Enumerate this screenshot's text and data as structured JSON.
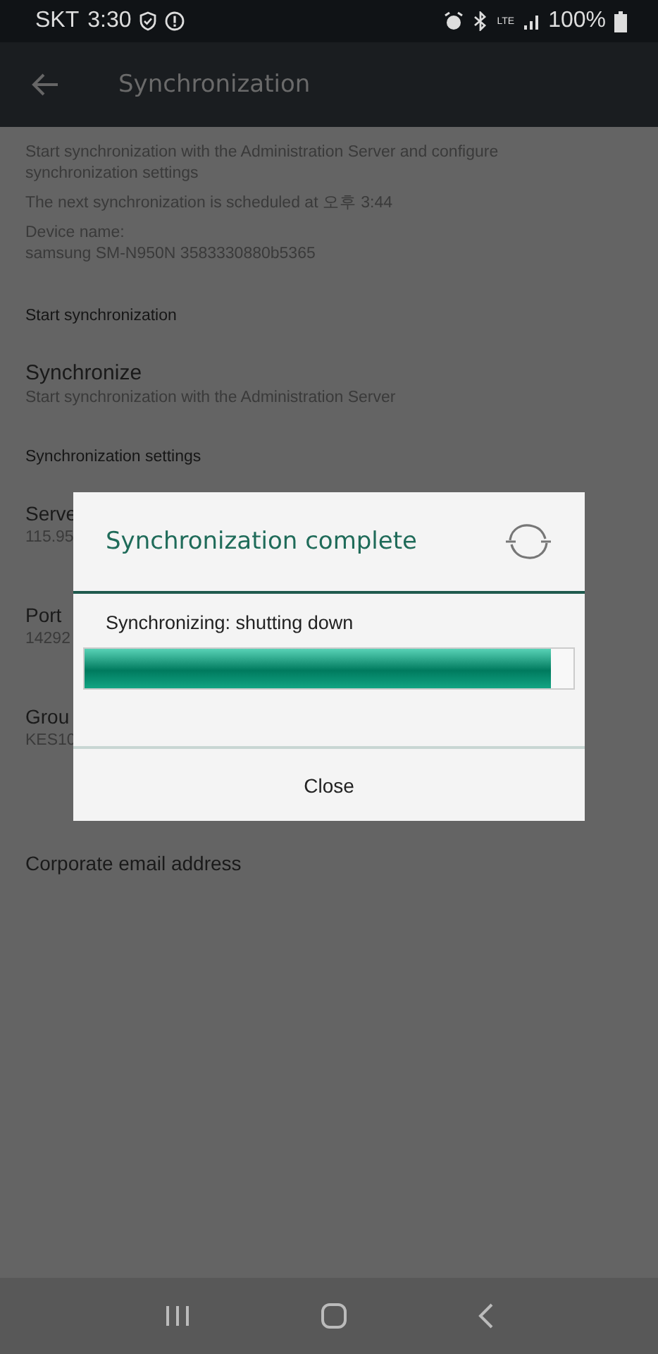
{
  "status_bar": {
    "carrier": "SKT",
    "time": "3:30",
    "network": "LTE",
    "battery": "100%"
  },
  "app_bar": {
    "title": "Synchronization"
  },
  "intro": {
    "description": "Start synchronization with the Administration Server and configure synchronization settings",
    "schedule": "The next synchronization is scheduled at 오후 3:44",
    "device_label": "Device name:",
    "device_name": "samsung SM-N950N 3583330880b5365"
  },
  "sections": [
    {
      "header": "Start synchronization",
      "items": [
        {
          "title": "Synchronize",
          "subtitle": "Start synchronization with the Administration Server"
        }
      ]
    },
    {
      "header": "Synchronization settings",
      "items": [
        {
          "title": "Serve",
          "subtitle": "115.95"
        },
        {
          "title": "Port",
          "subtitle": "14292"
        },
        {
          "title": "Grou",
          "subtitle": "KES10"
        },
        {
          "title": "Corporate email address"
        }
      ]
    }
  ],
  "dialog": {
    "title": "Synchronization complete",
    "message": "Synchronizing: shutting down",
    "progress": {
      "level": 0.954
    },
    "button": "Close"
  }
}
